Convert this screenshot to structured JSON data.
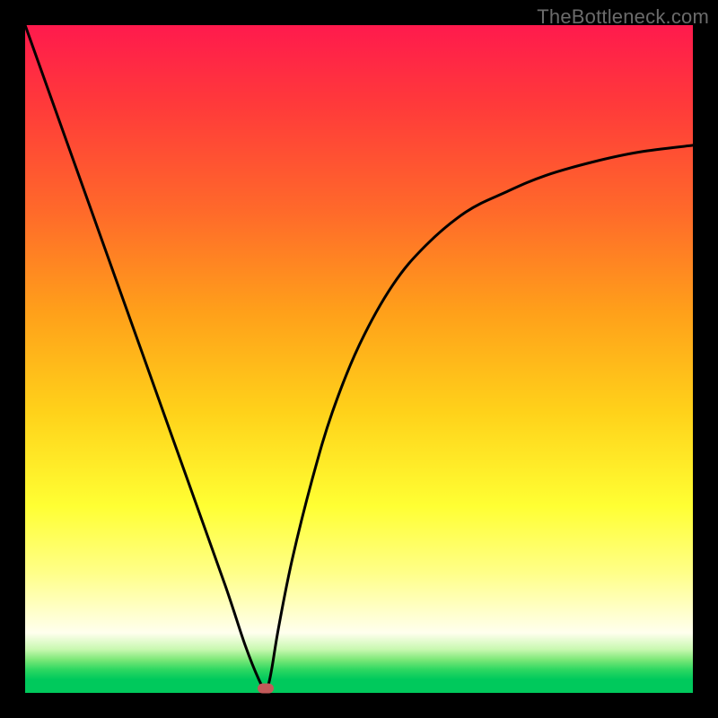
{
  "watermark": "TheBottleneck.com",
  "chart_data": {
    "type": "line",
    "title": "",
    "xlabel": "",
    "ylabel": "",
    "xlim": [
      0,
      100
    ],
    "ylim": [
      0,
      100
    ],
    "grid": false,
    "series": [
      {
        "name": "curve",
        "x": [
          0,
          5,
          10,
          15,
          20,
          25,
          30,
          33,
          35,
          36,
          36.5,
          37,
          38,
          40,
          43,
          46,
          50,
          55,
          60,
          66,
          72,
          78,
          85,
          92,
          100
        ],
        "values": [
          100,
          86,
          72,
          58,
          44,
          30,
          16,
          7,
          2,
          0.5,
          1.5,
          4,
          10,
          20,
          32,
          42,
          52,
          61,
          67,
          72,
          75,
          77.5,
          79.5,
          81,
          82
        ]
      }
    ],
    "marker": {
      "x": 36,
      "y": 0.7,
      "color": "#c35a5a"
    },
    "background_gradient": {
      "top": "#ff1a4d",
      "mid": "#ffff33",
      "bottom": "#00c95c"
    }
  }
}
